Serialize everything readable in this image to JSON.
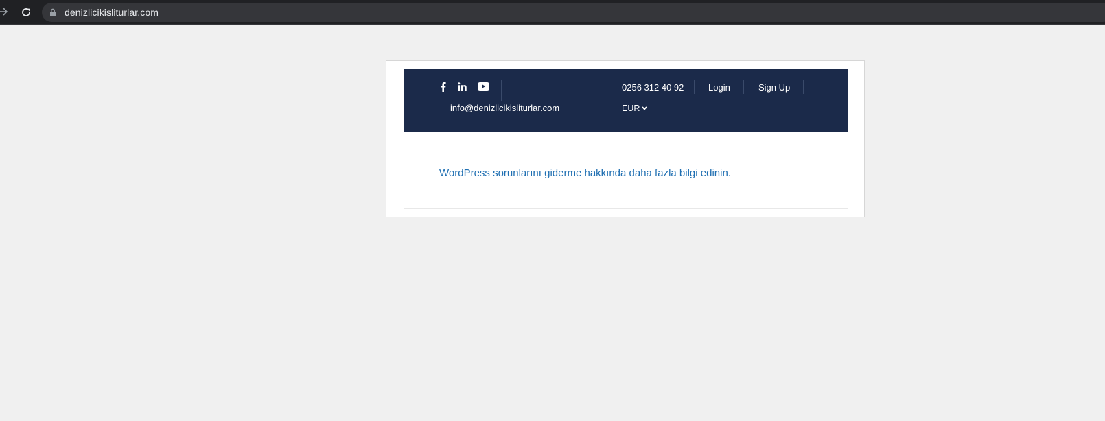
{
  "browser": {
    "url": "denizlicikisliturlar.com"
  },
  "topbar": {
    "social_icons": [
      "facebook-icon",
      "linkedin-icon",
      "youtube-icon"
    ],
    "email": "info@denizlicikisliturlar.com",
    "phone": "0256 312 40 92",
    "login_label": "Login",
    "signup_label": "Sign Up",
    "currency": "EUR"
  },
  "main": {
    "help_link": "WordPress sorunlarını giderme hakkında daha fazla bilgi edinin."
  },
  "colors": {
    "topbar_bg": "#1b2a4a",
    "link": "#1f6fb2",
    "page_bg": "#f0f0f0"
  }
}
